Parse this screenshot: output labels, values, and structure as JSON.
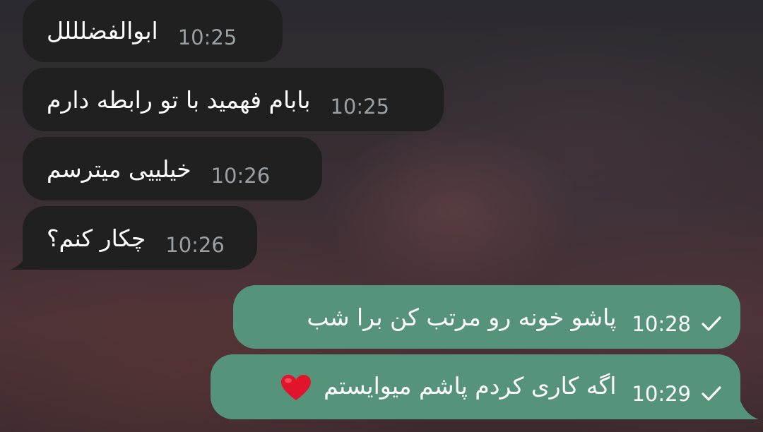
{
  "messages": [
    {
      "direction": "incoming",
      "text": "ابوالفضلللل",
      "time": "10:25"
    },
    {
      "direction": "incoming",
      "text": "بابام فهمید با تو رابطه دارم",
      "time": "10:25"
    },
    {
      "direction": "incoming",
      "text": "خیلییی میترسم",
      "time": "10:26"
    },
    {
      "direction": "incoming",
      "text": "چکار کنم؟",
      "time": "10:26"
    },
    {
      "direction": "outgoing",
      "text": "پاشو خونه رو مرتب کن برا شب",
      "time": "10:28",
      "status": "sent"
    },
    {
      "direction": "outgoing",
      "text": "اگه کاری کردم پاشم میوایستم",
      "time": "10:29",
      "status": "sent",
      "emoji": "heart"
    }
  ],
  "colors": {
    "incoming_bubble": "#202020",
    "outgoing_bubble": "#56937b",
    "incoming_time": "#9aa0a4",
    "heart": "#e0152b"
  },
  "icons": {
    "status": "checkmark-icon",
    "emoji": "red-heart-icon"
  }
}
